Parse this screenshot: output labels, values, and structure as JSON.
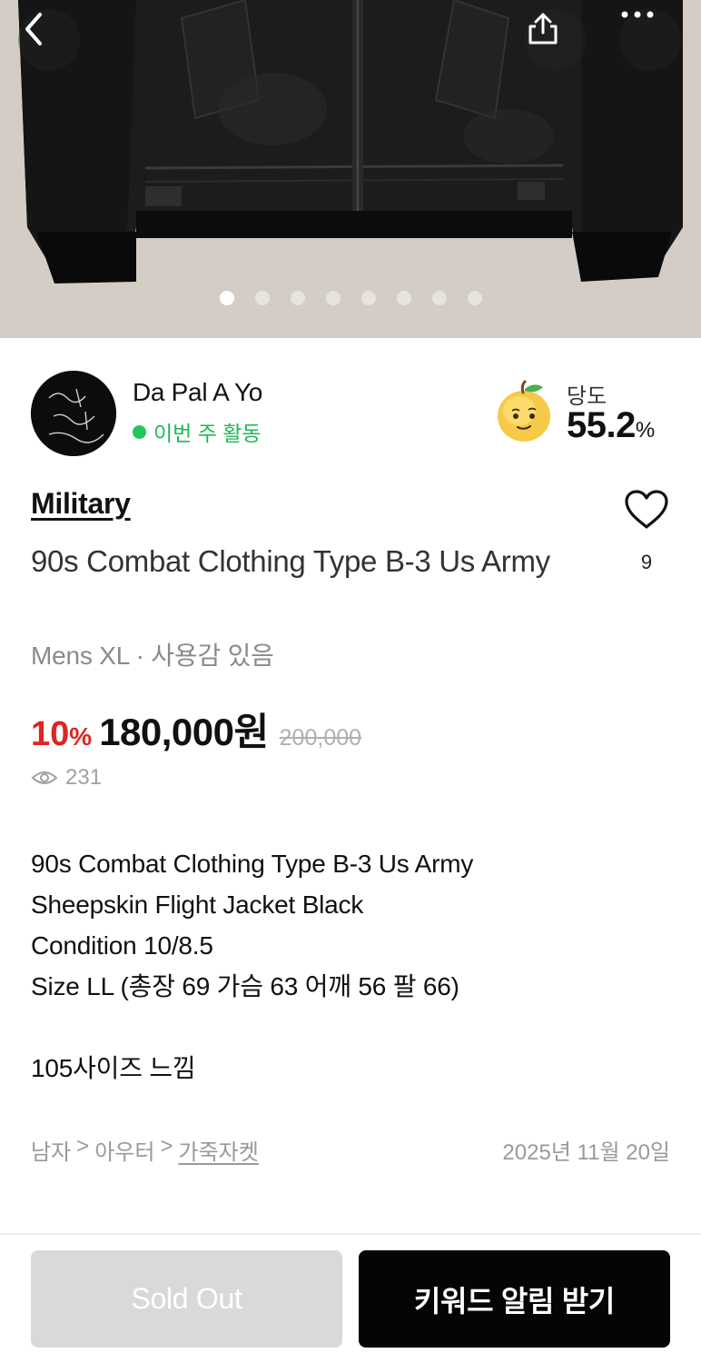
{
  "hero": {
    "image_label": "Black sheepskin flight jacket photo",
    "dots_total": 8,
    "dots_active_index": 0,
    "icons": {
      "back": "chevron-left-icon",
      "share": "share-icon",
      "more": "more-horizontal-icon"
    }
  },
  "seller": {
    "name": "Da Pal A Yo",
    "activity": "이번 주 활동",
    "sweetness_label": "당도",
    "sweetness_value": "55.2",
    "sweetness_unit": "%"
  },
  "product": {
    "brand": "Military",
    "title": "90s Combat Clothing Type B-3 Us Army",
    "meta": "Mens XL · 사용감 있음",
    "likes": "9",
    "discount": "10",
    "discount_unit": "%",
    "price": "180,000원",
    "original_price": "200,000",
    "views": "231"
  },
  "description": {
    "lines": [
      "90s Combat Clothing Type B-3 Us Army",
      "Sheepskin Flight Jacket Black",
      "Condition 10/8.5",
      "Size LL (총장 69 가슴 63 어깨 56 팔 66)",
      "",
      "105사이즈 느낌"
    ]
  },
  "category": {
    "level1": "남자",
    "sep": ">",
    "level2": "아우터",
    "level3": "가죽자켓",
    "date": "2025년 11월 20일"
  },
  "actions": {
    "sold_out": "Sold Out",
    "keyword_alert": "키워드 알림 받기"
  },
  "colors": {
    "accent_red": "#e02424",
    "active_green": "#22c55e",
    "primary_black": "#050505",
    "disabled_gray": "#d9d9d9"
  }
}
